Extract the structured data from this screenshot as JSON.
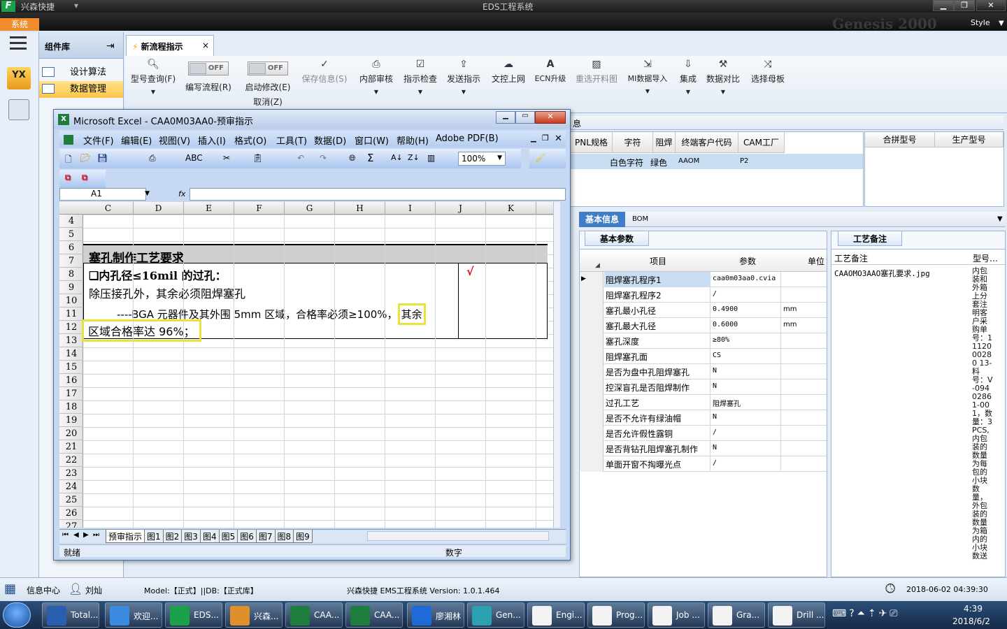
{
  "app": {
    "company": "兴森快捷",
    "window_title": "EDS工程系统",
    "system_menu": "系统",
    "style_label": "Style",
    "watermark": "Genesis 2000"
  },
  "panel": {
    "title": "组件库",
    "items": [
      "设计算法",
      "数据管理"
    ]
  },
  "doc_tab": {
    "label": "新流程指示"
  },
  "ribbon": {
    "buttons": [
      {
        "label": "型号查询(F)",
        "icon": "search-icon",
        "enabled": true
      },
      {
        "label": "编写流程(R)",
        "toggle": "OFF",
        "enabled": true
      },
      {
        "label": "启动修改(E)",
        "toggle": "OFF",
        "extra": "取消(Z)",
        "enabled": true
      },
      {
        "label": "保存信息(S)",
        "icon": "check-icon",
        "enabled": false
      },
      {
        "label": "内部审核",
        "icon": "print-icon",
        "enabled": true
      },
      {
        "label": "指示检查",
        "icon": "checkbox-icon",
        "enabled": true
      },
      {
        "label": "发送指示",
        "icon": "upload-icon",
        "enabled": true
      },
      {
        "label": "文控上网",
        "icon": "cloud-upload-icon",
        "enabled": true
      },
      {
        "label": "ECN升级",
        "icon": "ecn-icon",
        "enabled": true
      },
      {
        "label": "重选开料图",
        "icon": "image-icon",
        "enabled": false
      },
      {
        "label": "MI数据导入",
        "icon": "import-icon",
        "enabled": true
      },
      {
        "label": "集成",
        "icon": "download-icon",
        "enabled": true
      },
      {
        "label": "数据对比",
        "icon": "compare-icon",
        "enabled": true
      },
      {
        "label": "选择母板",
        "icon": "shuffle-icon",
        "enabled": true
      }
    ]
  },
  "info_grid": {
    "partial_label": "息",
    "headers": [
      "PNL规格",
      "字符",
      "阻焊",
      "终端客户代码",
      "CAM工厂"
    ],
    "row": [
      "",
      "白色字符",
      "绿色",
      "AAOM",
      "P2"
    ],
    "right_headers": [
      "合拼型号",
      "生产型号"
    ]
  },
  "detail_tabs": [
    "基本信息",
    "BOM"
  ],
  "params": {
    "tab": "基本参数",
    "headers": [
      "项目",
      "参数",
      "单位"
    ],
    "rows": [
      [
        "阻焊塞孔程序1",
        "caa0m03aa0.cvia",
        ""
      ],
      [
        "阻焊塞孔程序2",
        "/",
        ""
      ],
      [
        "塞孔最小孔径",
        "0.4900",
        "mm"
      ],
      [
        "塞孔最大孔径",
        "0.6000",
        "mm"
      ],
      [
        "塞孔深度",
        "≥80%",
        ""
      ],
      [
        "阻焊塞孔面",
        "CS",
        ""
      ],
      [
        "是否为盘中孔阻焊塞孔",
        "N",
        ""
      ],
      [
        "控深盲孔是否阻焊制作",
        "N",
        ""
      ],
      [
        "过孔工艺",
        "阻焊塞孔",
        ""
      ],
      [
        "是否不允许有绿油帽",
        "N",
        ""
      ],
      [
        "是否允许假性露铜",
        "/",
        ""
      ],
      [
        "是否背钻孔阻焊塞孔制作",
        "N",
        ""
      ],
      [
        "单面开窗不掏曝光点",
        "/",
        ""
      ]
    ]
  },
  "remarks": {
    "tab": "工艺备注",
    "header": "工艺备注",
    "col2": "型号…",
    "item": "CAAOMO3AAO塞孔要求.jpg",
    "vertical_text": "内包装和外箱上分套注明客户采购单号：1112000280 13-料号：V-09402861-001，数量：3PCS,内包装的数量为每包的小块数量，外包装的数量为箱内的小块数送"
  },
  "excel": {
    "title": "Microsoft Excel - CAA0M03AA0-预审指示",
    "menu": [
      "文件(F)",
      "编辑(E)",
      "视图(V)",
      "插入(I)",
      "格式(O)",
      "工具(T)",
      "数据(D)",
      "窗口(W)",
      "帮助(H)",
      "Adobe PDF(B)"
    ],
    "zoom": "100%",
    "name_box": "A1",
    "fx": "fx",
    "columns": [
      "C",
      "D",
      "E",
      "F",
      "G",
      "H",
      "I",
      "J",
      "K"
    ],
    "rows": [
      "4",
      "5",
      "6",
      "7",
      "8",
      "9",
      "10",
      "11",
      "12",
      "13",
      "14",
      "15",
      "16",
      "17",
      "18",
      "19",
      "20",
      "21",
      "22",
      "23",
      "24",
      "25",
      "26",
      "27"
    ],
    "heading": "塞孔制作工艺要求",
    "line1": "❑内孔径≤16mil 的过孔：",
    "line2": "除压接孔外，其余必须阻焊塞孔",
    "line3": "----BGA 元器件及其外围 5mm 区域，合格率必须≥100%，",
    "line3_hl": "其余",
    "line4": "区域合格率达 96%；",
    "checkmark": "√",
    "sheets": [
      "预审指示",
      "图1",
      "图2",
      "图3",
      "图4",
      "图5",
      "图6",
      "图7",
      "图8",
      "图9"
    ],
    "status_left": "就绪",
    "status_mid": "数字"
  },
  "statusbar": {
    "info_center": "信息中心",
    "user": "刘灿",
    "model": "Model:【正式】||DB:【正式库】",
    "version": "兴森快捷 EMS工程系统 Version: 1.0.1.464",
    "datetime": "2018-06-02 04:39:30"
  },
  "taskbar": {
    "items": [
      "Total...",
      "欢迎...",
      "EDS...",
      "兴森...",
      "CAA...",
      "CAA...",
      "廖湘林",
      "Gen...",
      "Engi...",
      "Prog...",
      "Job ...",
      "Gra...",
      "Drill ..."
    ],
    "time": "4:39",
    "date": "2018/6/2"
  }
}
